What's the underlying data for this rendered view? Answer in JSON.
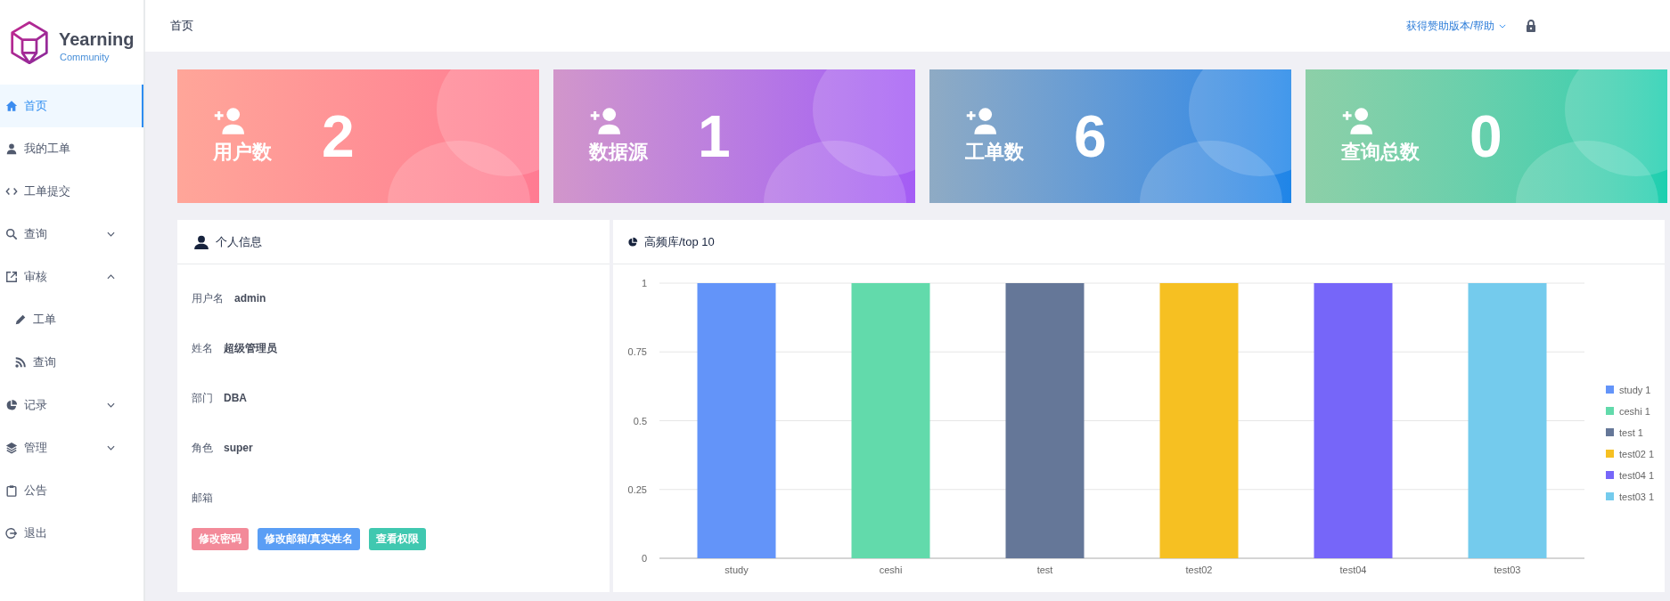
{
  "brand": {
    "name": "Yearning",
    "edition": "Community"
  },
  "sidebar": {
    "items": [
      {
        "label": "首页",
        "selected": true
      },
      {
        "label": "我的工单",
        "selected": false
      },
      {
        "label": "工单提交",
        "selected": false
      },
      {
        "label": "查询",
        "selected": false,
        "expanded": false
      },
      {
        "label": "审核",
        "selected": false,
        "expanded": true,
        "children": [
          {
            "label": "工单",
            "selected": false
          },
          {
            "label": "查询",
            "selected": false
          }
        ]
      },
      {
        "label": "记录",
        "selected": false,
        "expanded": false
      },
      {
        "label": "管理",
        "selected": false,
        "expanded": false
      },
      {
        "label": "公告",
        "selected": false
      },
      {
        "label": "退出",
        "selected": false
      }
    ]
  },
  "header": {
    "breadcrumb": "首页",
    "help_menu": "获得赞助版本/帮助"
  },
  "stat_cards": [
    {
      "label": "用户数",
      "value": "2",
      "color": "#ff7b92"
    },
    {
      "label": "数据源",
      "value": "1",
      "color": "#a45cf5"
    },
    {
      "label": "工单数",
      "value": "6",
      "color": "#1e85e8"
    },
    {
      "label": "查询总数",
      "value": "0",
      "color": "#1bcfb0"
    }
  ],
  "profile": {
    "title": "个人信息",
    "fields": [
      {
        "label": "用户名",
        "value": "admin"
      },
      {
        "label": "姓名",
        "value": "超级管理员"
      },
      {
        "label": "部门",
        "value": "DBA"
      },
      {
        "label": "角色",
        "value": "super"
      },
      {
        "label": "邮箱"
      }
    ],
    "buttons": [
      {
        "label": "修改密码",
        "color": "#f38a99"
      },
      {
        "label": "修改邮箱/真实姓名",
        "color": "#5a9ef5"
      },
      {
        "label": "查看权限",
        "color": "#40c8b0"
      }
    ]
  },
  "chart_panel": {
    "title": "高频库/top 10",
    "chart_data": {
      "type": "bar",
      "categories": [
        "study",
        "ceshi",
        "test",
        "test02",
        "test04",
        "test03"
      ],
      "values": [
        1,
        1,
        1,
        1,
        1,
        1
      ],
      "ylim": [
        0,
        1
      ],
      "grid": true,
      "yticks": [
        0,
        0.25,
        0.5,
        0.75,
        1
      ]
    },
    "legend": [
      {
        "name": "study",
        "value": "1",
        "color": "#6394f9"
      },
      {
        "name": "ceshi",
        "value": "1",
        "color": "#62daab"
      },
      {
        "name": "test",
        "value": "1",
        "color": "#657798"
      },
      {
        "name": "test02",
        "value": "1",
        "color": "#f6c022"
      },
      {
        "name": "test04",
        "value": "1",
        "color": "#7666f9"
      },
      {
        "name": "test03",
        "value": "1",
        "color": "#74cbed"
      }
    ]
  }
}
